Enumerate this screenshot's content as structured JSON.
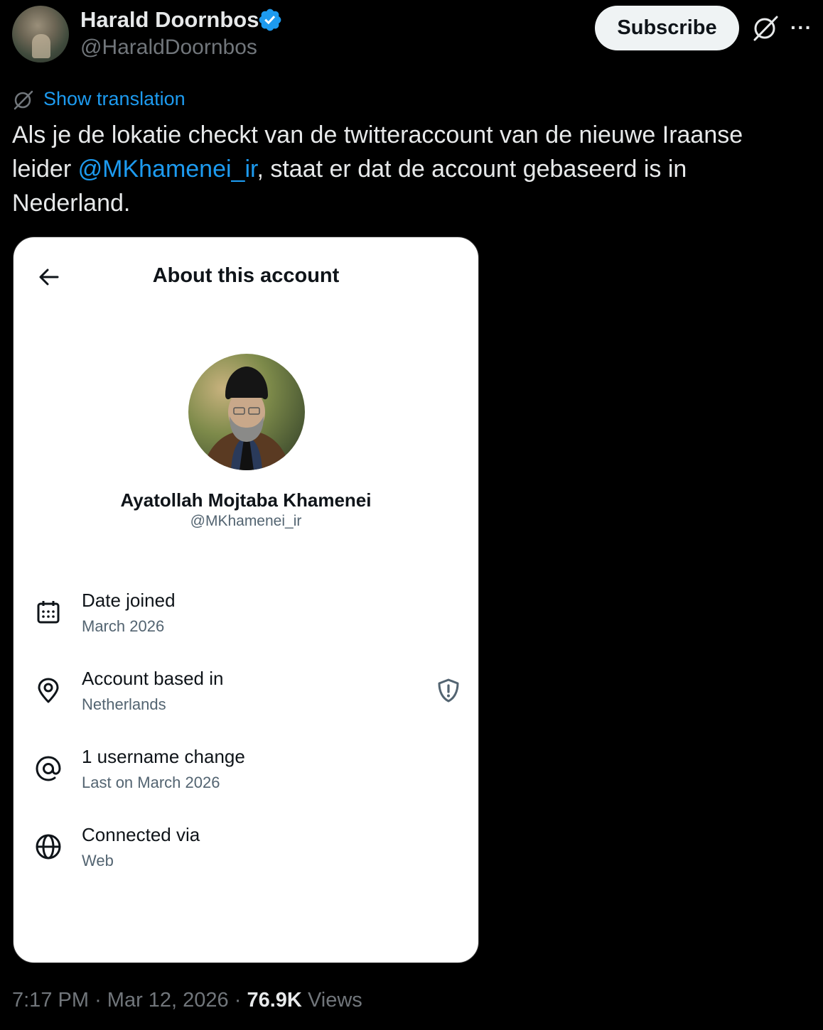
{
  "tweet": {
    "author_name": "Harald Doornbos",
    "author_handle": "@HaraldDoornbos",
    "subscribe_label": "Subscribe",
    "translate_label": "Show translation",
    "text_part1": "Als je de lokatie checkt van de twitteraccount van de nieuwe Iraanse leider ",
    "mention": "@MKhamenei_ir",
    "text_part2": ", staat er dat de account gebaseerd is in Nederland.",
    "time": "7:17 PM",
    "separator": "·",
    "date": "Mar 12, 2026",
    "views_count": "76.9K",
    "views_label": "Views"
  },
  "card": {
    "title": "About this account",
    "profile_name": "Ayatollah Mojtaba Khamenei",
    "profile_handle": "@MKhamenei_ir",
    "rows": [
      {
        "icon": "calendar-icon",
        "title": "Date joined",
        "sub": "March 2026"
      },
      {
        "icon": "location-pin-icon",
        "title": "Account based in",
        "sub": "Netherlands"
      },
      {
        "icon": "at-sign-icon",
        "title": "1 username change",
        "sub": "Last on March 2026"
      },
      {
        "icon": "globe-icon",
        "title": "Connected via",
        "sub": "Web"
      }
    ]
  },
  "colors": {
    "background": "#000000",
    "link": "#1d9bf0",
    "verified": "#1d9bf0",
    "muted": "#71767b"
  }
}
